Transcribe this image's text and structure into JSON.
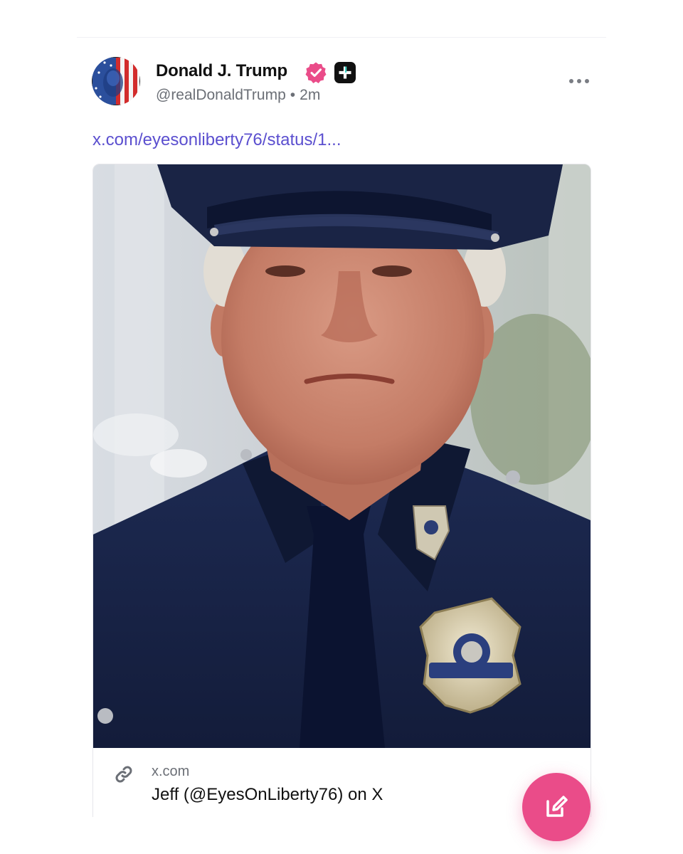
{
  "post": {
    "author": {
      "display_name": "Donald J. Trump",
      "handle": "@realDonaldTrump",
      "time_ago": "2m",
      "avatar_icon": "flag-portrait-avatar",
      "verified_icon": "verified-badge-icon",
      "badge_icon": "plus-badge-icon"
    },
    "separator": "•",
    "link_text": "x.com/eyesonliberty76/status/1...",
    "more_icon": "more-horizontal-icon",
    "card": {
      "image_alt": "Portrait of a man in a police uniform and cap with a badge",
      "domain": "x.com",
      "title": "Jeff (@EyesOnLiberty76) on X",
      "link_icon": "link-icon"
    },
    "fab": {
      "icon": "compose-icon"
    }
  },
  "colors": {
    "accent_link": "#5b4fcf",
    "verified_pink": "#ea4c89",
    "fab_pink": "#ea4c89",
    "text_primary": "#111111",
    "text_secondary": "#6b6f76"
  }
}
